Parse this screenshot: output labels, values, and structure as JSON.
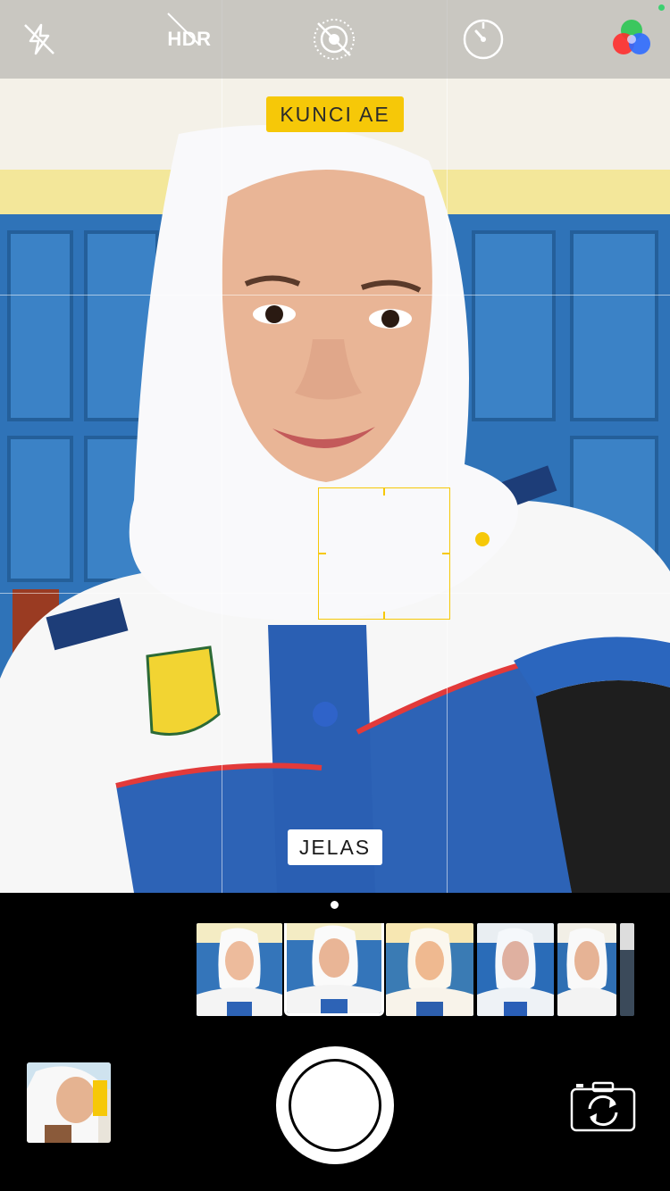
{
  "top_bar": {
    "flash_icon": "flash-off-icon",
    "hdr_label": "HDR",
    "live_icon": "live-photo-off-icon",
    "timer_icon": "timer-icon",
    "filters_icon": "filters-icon"
  },
  "overlay": {
    "ae_lock_label": "KUNCI AE",
    "filter_name": "JELAS"
  },
  "filter_strip": {
    "selected_index": 1,
    "count": 5
  },
  "colors": {
    "accent_yellow": "#F6C808",
    "status_green": "#3CD070"
  }
}
